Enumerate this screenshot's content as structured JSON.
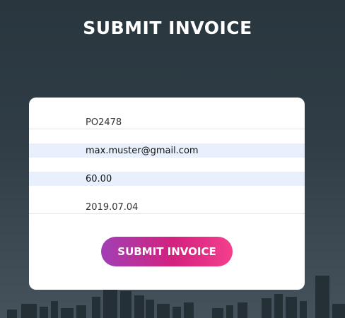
{
  "header": {
    "title": "SUBMIT INVOICE"
  },
  "form": {
    "fields": [
      {
        "value": "PO2478",
        "autofilled": false
      },
      {
        "value": "max.muster@gmail.com",
        "autofilled": true
      },
      {
        "value": "60.00",
        "autofilled": true
      },
      {
        "value": "2019.07.04",
        "autofilled": false
      }
    ],
    "submit_label": "SUBMIT INVOICE"
  },
  "colors": {
    "background": "#303d46",
    "autofill": "#e8f0fe",
    "button_gradient": [
      "#a13fb5",
      "#d3217f",
      "#f43f8d"
    ]
  }
}
